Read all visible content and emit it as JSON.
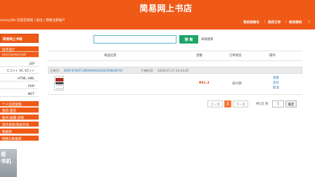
{
  "header": {
    "title": "简易网上书店",
    "welcome": "sunny|Wx 欢迎您来到 | 退出 | 我要注册账户",
    "nav": [
      "我的购物车",
      "我的订单",
      "修改密码",
      "|"
    ]
  },
  "sidebar": {
    "category_title": "简易网上书城",
    "categories": [
      "程序设计",
      "Java Javascript",
      "JSP",
      "C C++ VC VC++",
      "HTML XML",
      "PHP",
      ".NET"
    ],
    "my_title": "个人信息管理",
    "my_items": [
      "我的-首页",
      "图书-收藏-详情",
      "操作系统/系统开发",
      "数据库",
      "网络与数据库"
    ],
    "corner_logo": "易\n书机"
  },
  "search": {
    "placeholder": "",
    "button_label": "搜 索",
    "advanced_link": "高级搜索"
  },
  "table": {
    "columns": [
      "商品信息",
      "金额",
      "订单状态",
      "操作"
    ]
  },
  "order": {
    "number_label": "订单号：",
    "number": "856F4F6AF539E99A001D04C99B4B7AC",
    "time_label": "下单时间：",
    "time": "2018-07-27 23:34:45",
    "amount": "¥41.3",
    "status": "未付款",
    "actions": [
      "查看",
      "支付",
      "取消"
    ]
  },
  "pagination": {
    "prev": "上一页",
    "current_page": "1",
    "next": "下一页",
    "summary": "共1页 到",
    "page_unit": "页",
    "goto_value": "1",
    "confirm": "确定"
  },
  "colors": {
    "brand": "#ef5a17",
    "search_button": "#1ea56b",
    "link": "#2a79bf"
  }
}
